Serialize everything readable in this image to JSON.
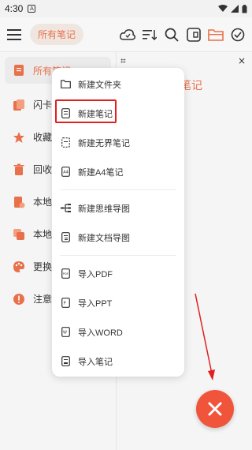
{
  "status_bar": {
    "time": "4:30",
    "notif_glyph": "A"
  },
  "toolbar": {
    "folder_chip": "所有笔记",
    "icons": [
      "menu-icon",
      "cloud-sync-icon",
      "sort-icon",
      "search-icon",
      "layout-icon",
      "folder-icon",
      "check-circle-icon"
    ]
  },
  "sidebar": {
    "items": [
      {
        "label": "所有笔记",
        "icon": "note-icon",
        "color": "#e8704a"
      },
      {
        "label": "闪卡",
        "icon": "flashcard-icon",
        "color": "#e8704a"
      },
      {
        "label": "收藏",
        "icon": "star-icon",
        "color": "#e8704a"
      },
      {
        "label": "回收",
        "icon": "trash-icon",
        "color": "#e8704a"
      },
      {
        "label": "本地",
        "icon": "local-icon",
        "color": "#e8704a"
      },
      {
        "label": "本地",
        "icon": "backup-icon",
        "color": "#e8704a"
      },
      {
        "label": "更换",
        "icon": "palette-icon",
        "color": "#e8704a"
      },
      {
        "label": "注意",
        "icon": "notice-icon",
        "color": "#e8704a"
      }
    ]
  },
  "right_pane": {
    "title_fragment": "笔记",
    "close_glyph": "×",
    "expand_glyph": "⌗"
  },
  "menu": {
    "group1": [
      {
        "label": "新建文件夹",
        "icon": "folder-outline-icon"
      },
      {
        "label": "新建笔记",
        "icon": "note-outline-icon"
      },
      {
        "label": "新建无界笔记",
        "icon": "dashed-note-icon"
      },
      {
        "label": "新建A4笔记",
        "icon": "a4-note-icon"
      }
    ],
    "group2": [
      {
        "label": "新建思维导图",
        "icon": "mindmap-icon"
      },
      {
        "label": "新建文档导图",
        "icon": "doc-map-icon"
      }
    ],
    "group3": [
      {
        "label": "导入PDF",
        "icon": "pdf-icon"
      },
      {
        "label": "导入PPT",
        "icon": "ppt-icon"
      },
      {
        "label": "导入WORD",
        "icon": "word-icon"
      },
      {
        "label": "导入笔记",
        "icon": "import-note-icon"
      }
    ]
  },
  "fab": {
    "glyph": "✕",
    "color": "#f0553c"
  },
  "accent_color": "#e8704a",
  "annotation_color": "#e02020"
}
